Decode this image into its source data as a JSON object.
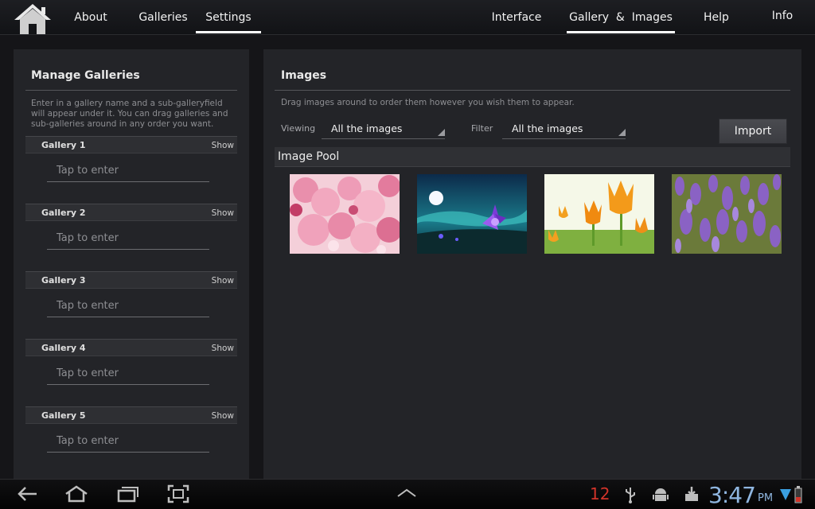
{
  "topbar": {
    "tabs": {
      "about": "About",
      "galleries": "Galleries",
      "settings": "Settings",
      "interface": "Interface",
      "gallery_images": "Gallery  &  Images",
      "help": "Help",
      "info": "Info"
    }
  },
  "manage": {
    "title": "Manage Galleries",
    "help_lines": [
      "Enter in a gallery name and a sub-galleryfield",
      "will appear under it. You can drag galleries and",
      "sub-galleries around in any order you want."
    ],
    "galleries": [
      {
        "name": "Gallery 1",
        "show": "Show",
        "placeholder": "Tap to enter"
      },
      {
        "name": "Gallery 2",
        "show": "Show",
        "placeholder": "Tap to enter"
      },
      {
        "name": "Gallery 3",
        "show": "Show",
        "placeholder": "Tap to enter"
      },
      {
        "name": "Gallery 4",
        "show": "Show",
        "placeholder": "Tap to enter"
      },
      {
        "name": "Gallery 5",
        "show": "Show",
        "placeholder": "Tap to enter"
      }
    ]
  },
  "images": {
    "title": "Images",
    "help": "Drag images around to order them however you wish them to appear.",
    "viewing_label": "Viewing",
    "viewing_value": "All the images",
    "filter_label": "Filter",
    "filter_value": "All the images",
    "import_label": "Import",
    "pool_title": "Image Pool",
    "thumbnails": [
      "cherry-blossom-image",
      "night-flower-image",
      "orange-tulips-image",
      "lavender-field-image"
    ]
  },
  "system": {
    "notification_count": "12",
    "time": "3:47",
    "ampm": "PM"
  },
  "colors": {
    "panel_bg": "#232428",
    "page_bg": "#151518",
    "clock": "#8fb6e0",
    "notification": "#d2342a"
  }
}
